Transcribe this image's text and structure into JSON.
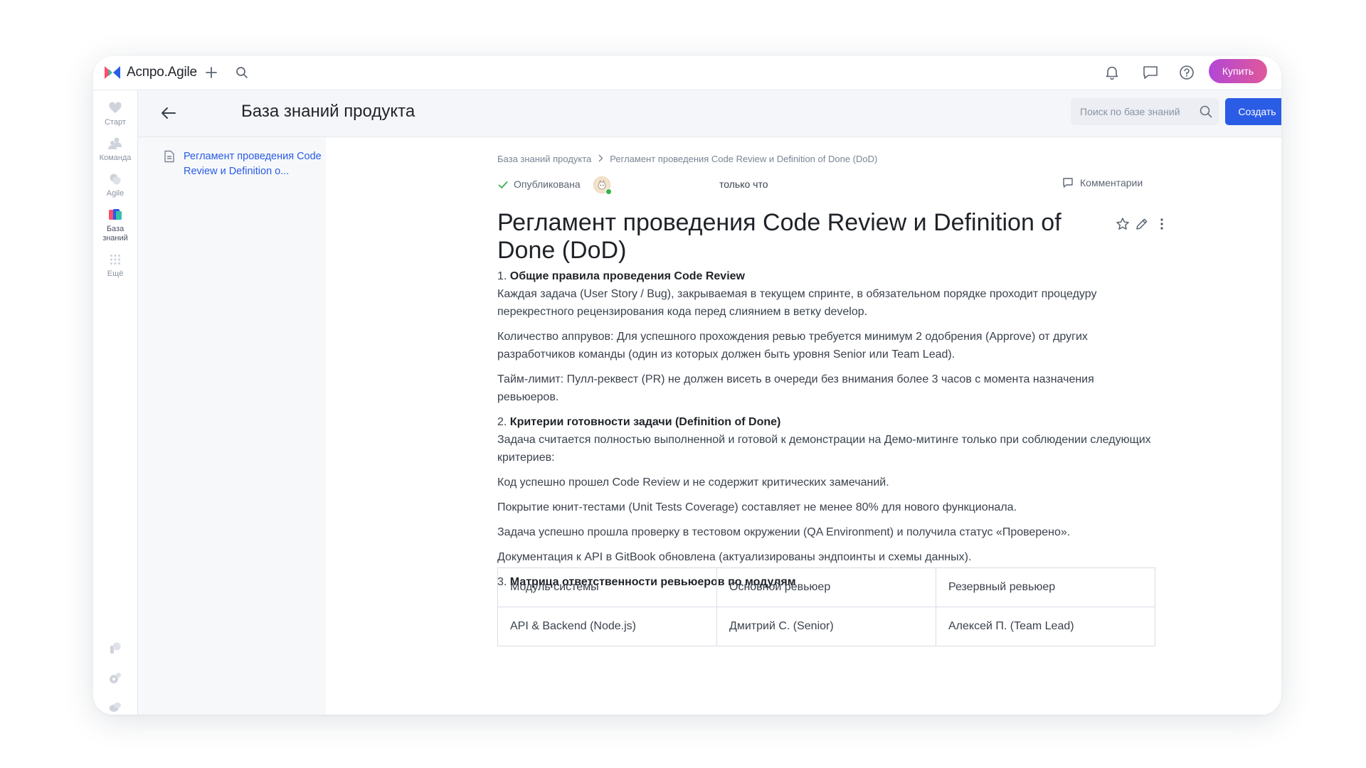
{
  "app": {
    "name": "Аспро.Agile",
    "buy_label": "Купить"
  },
  "rail": {
    "items": [
      {
        "label": "Старт",
        "icon": "heart-icon"
      },
      {
        "label": "Команда",
        "icon": "team-icon"
      },
      {
        "label": "Agile",
        "icon": "agile-icon"
      },
      {
        "label": "База знаний",
        "label_line1": "База",
        "label_line2": "знаний",
        "icon": "knowledge-base-icon",
        "active": true
      },
      {
        "label": "Ещё",
        "icon": "grid-dots-icon"
      }
    ],
    "bottom_icons": [
      "integration-icon",
      "settings-gear-icon",
      "chat-bubbles-icon"
    ]
  },
  "header": {
    "title": "База знаний продукта",
    "search_placeholder": "Поиск по базе знаний",
    "create_label": "Создать"
  },
  "tree": {
    "item_label": "Регламент проведения Code Review и Definition o..."
  },
  "breadcrumb": {
    "root": "База знаний продукта",
    "current": "Регламент проведения Code Review и Definition of Done (DoD)"
  },
  "status": {
    "state": "Опубликована",
    "time": "только что",
    "comments_label": "Комментарии"
  },
  "document": {
    "title": "Регламент проведения Code Review и Definition of Done (DoD)",
    "s1_num": "1.",
    "s1_heading": "Общие правила проведения Code Review",
    "s1_intro": "Каждая задача (User Story / Bug), закрываемая в текущем спринте, в обязательном порядке проходит процедуру перекрестного рецензирования кода перед слиянием в ветку develop.",
    "s1_p2": "Количество аппрувов: Для успешного прохождения ревью требуется минимум 2 одобрения (Approve) от других разработчиков команды (один из которых должен быть уровня Senior или Team Lead).",
    "s1_p3": "Тайм-лимит: Пулл-реквест (PR) не должен висеть в очереди без внимания более 3 часов с момента назначения ревьюеров.",
    "s2_num": "2.",
    "s2_heading": "Критерии готовности задачи (Definition of Done)",
    "s2_intro": "Задача считается полностью выполненной и готовой к демонстрации на Демо-митинге только при соблюдении следующих критериев:",
    "s2_items": [
      "Код успешно прошел Code Review и не содержит критических замечаний.",
      "Покрытие юнит-тестами (Unit Tests Coverage) составляет не менее 80% для нового функционала.",
      "Задача успешно прошла проверку в тестовом окружении (QA Environment) и получила статус «Проверено».",
      "Документация к API в GitBook обновлена (актуализированы эндпоинты и схемы данных)."
    ],
    "s3_num": "3.",
    "s3_heading": "Матрица ответственности ревьюеров по модулям",
    "table": {
      "headers": [
        "Модуль системы",
        "Основной ревьюер",
        "Резервный ревьюер"
      ],
      "rows": [
        [
          "API & Backend (Node.js)",
          "Дмитрий С. (Senior)",
          "Алексей П. (Team Lead)"
        ]
      ]
    }
  },
  "colors": {
    "accent": "#2a5ce6",
    "buy_gradient_start": "#b247d6",
    "buy_gradient_end": "#e0589a",
    "published": "#38b24a"
  }
}
